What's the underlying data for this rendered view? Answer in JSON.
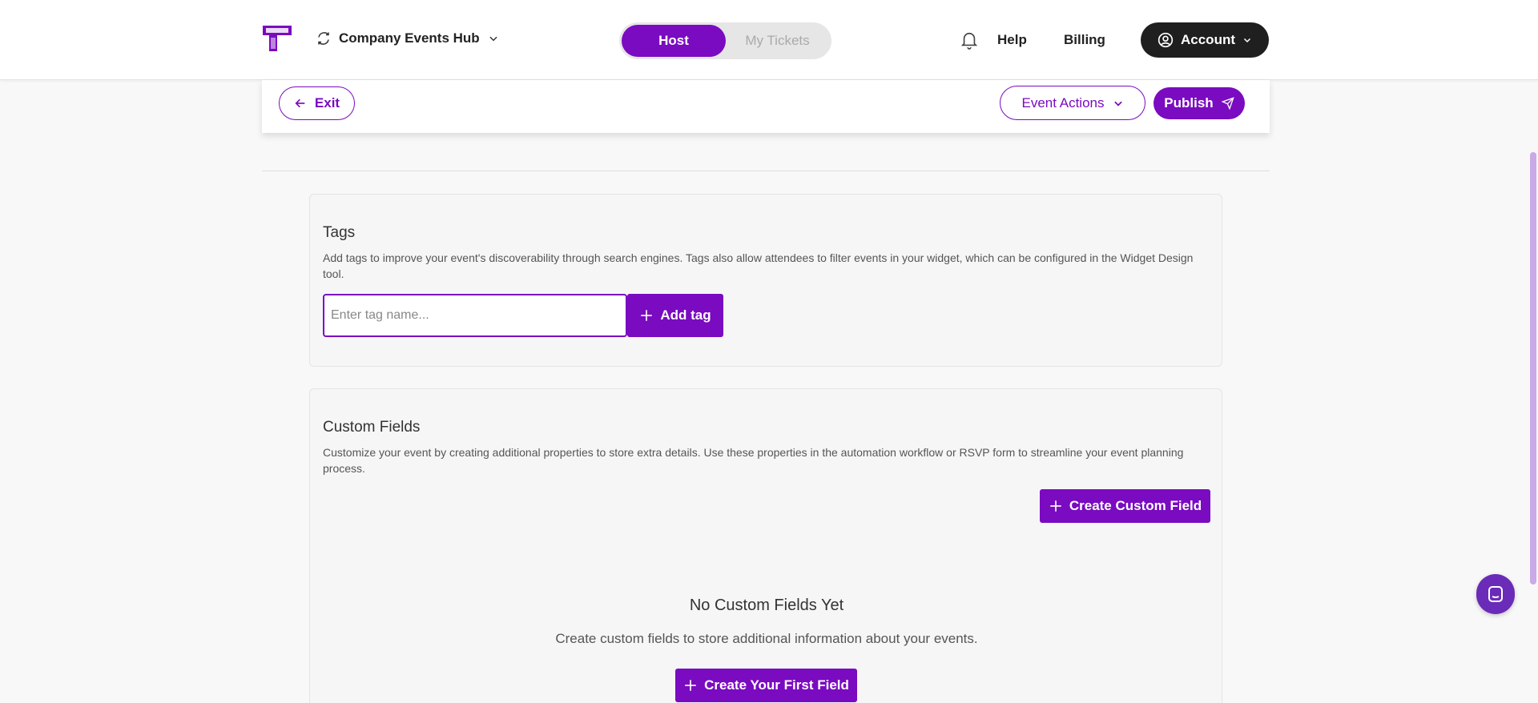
{
  "header": {
    "org_name": "Company Events Hub",
    "toggle": {
      "active": "Host",
      "inactive": "My Tickets"
    },
    "help": "Help",
    "billing": "Billing",
    "account": "Account"
  },
  "actionbar": {
    "exit": "Exit",
    "event_actions": "Event Actions",
    "publish": "Publish"
  },
  "tags": {
    "title": "Tags",
    "description": "Add tags to improve your event's discoverability through search engines. Tags also allow attendees to filter events in your widget, which can be configured in the Widget Design tool.",
    "input_placeholder": "Enter tag name...",
    "add_button": "Add tag"
  },
  "custom_fields": {
    "title": "Custom Fields",
    "description": "Customize your event by creating additional properties to store extra details. Use these properties in the automation workflow or RSVP form to streamline your event planning process.",
    "create_button": "Create Custom Field",
    "empty_title": "No Custom Fields Yet",
    "empty_description": "Create custom fields to store additional information about your events.",
    "first_field_button": "Create Your First Field"
  },
  "colors": {
    "accent": "#7a0bc0",
    "dark": "#1f1f1f",
    "chat": "#6a2bb8"
  },
  "icons": [
    "ticket-logo-icon",
    "sync-icon",
    "chevron-down-icon",
    "bell-icon",
    "user-circle-icon",
    "arrow-left-icon",
    "send-icon",
    "plus-icon",
    "chat-icon"
  ]
}
